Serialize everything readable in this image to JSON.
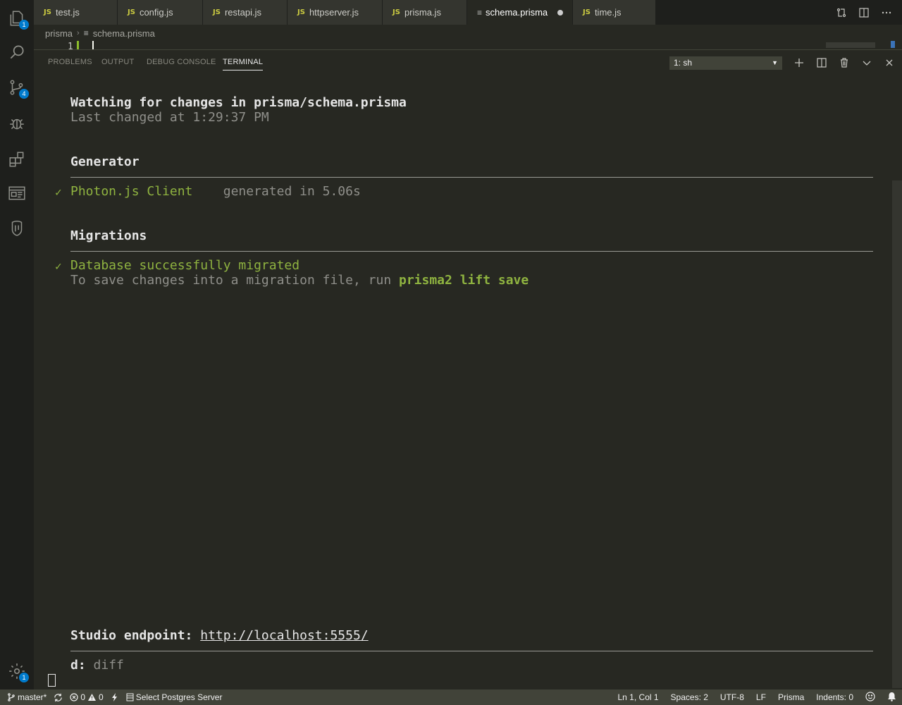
{
  "activity_bar": {
    "items": [
      {
        "name": "explorer",
        "badge": "1"
      },
      {
        "name": "search",
        "badge": ""
      },
      {
        "name": "source-control",
        "badge": "4"
      },
      {
        "name": "debug",
        "badge": ""
      },
      {
        "name": "extensions",
        "badge": ""
      },
      {
        "name": "remote-explorer",
        "badge": ""
      },
      {
        "name": "database",
        "badge": ""
      }
    ],
    "settings_badge": "1"
  },
  "tabs": [
    {
      "label": "test.js",
      "kind": "JS"
    },
    {
      "label": "config.js",
      "kind": "JS"
    },
    {
      "label": "restapi.js",
      "kind": "JS"
    },
    {
      "label": "httpserver.js",
      "kind": "JS"
    },
    {
      "label": "prisma.js",
      "kind": "JS"
    },
    {
      "label": "schema.prisma",
      "kind": "prisma",
      "active": true,
      "modified": true
    },
    {
      "label": "time.js",
      "kind": "JS"
    }
  ],
  "tab_kind_label": "JS",
  "breadcrumb": {
    "folder": "prisma",
    "file": "schema.prisma"
  },
  "editor": {
    "line_number": "1"
  },
  "panel": {
    "tabs": [
      "PROBLEMS",
      "OUTPUT",
      "DEBUG CONSOLE",
      "TERMINAL"
    ],
    "active_tab": "TERMINAL",
    "terminal_selector": "1: sh"
  },
  "terminal": {
    "watching_prefix": "Watching for changes in ",
    "watching_file": "prisma/schema.prisma",
    "last_changed": "Last changed at 1:29:37 PM",
    "generator_heading": "Generator",
    "generator_name": "Photon.js Client",
    "generator_time": "generated in 5.06s",
    "migrations_heading": "Migrations",
    "migration_status": "Database successfully migrated",
    "migration_hint_prefix": "To save changes into a migration file, run ",
    "migration_hint_cmd": "prisma2 lift save",
    "studio_label": "Studio endpoint:",
    "studio_url": "http://localhost:5555/",
    "key_hint_key": "d:",
    "key_hint_action": "diff",
    "check": "✓"
  },
  "statusbar": {
    "branch": "master*",
    "errors": "0",
    "warnings": "0",
    "server": "Select Postgres Server",
    "position": "Ln 1, Col 1",
    "spaces": "Spaces: 2",
    "encoding": "UTF-8",
    "eol": "LF",
    "language": "Prisma",
    "indents": "Indents: 0"
  },
  "colors": {
    "background": "#272822",
    "accent_green": "#8fb340",
    "badge_blue": "#007acc",
    "statusbar": "#414339"
  }
}
